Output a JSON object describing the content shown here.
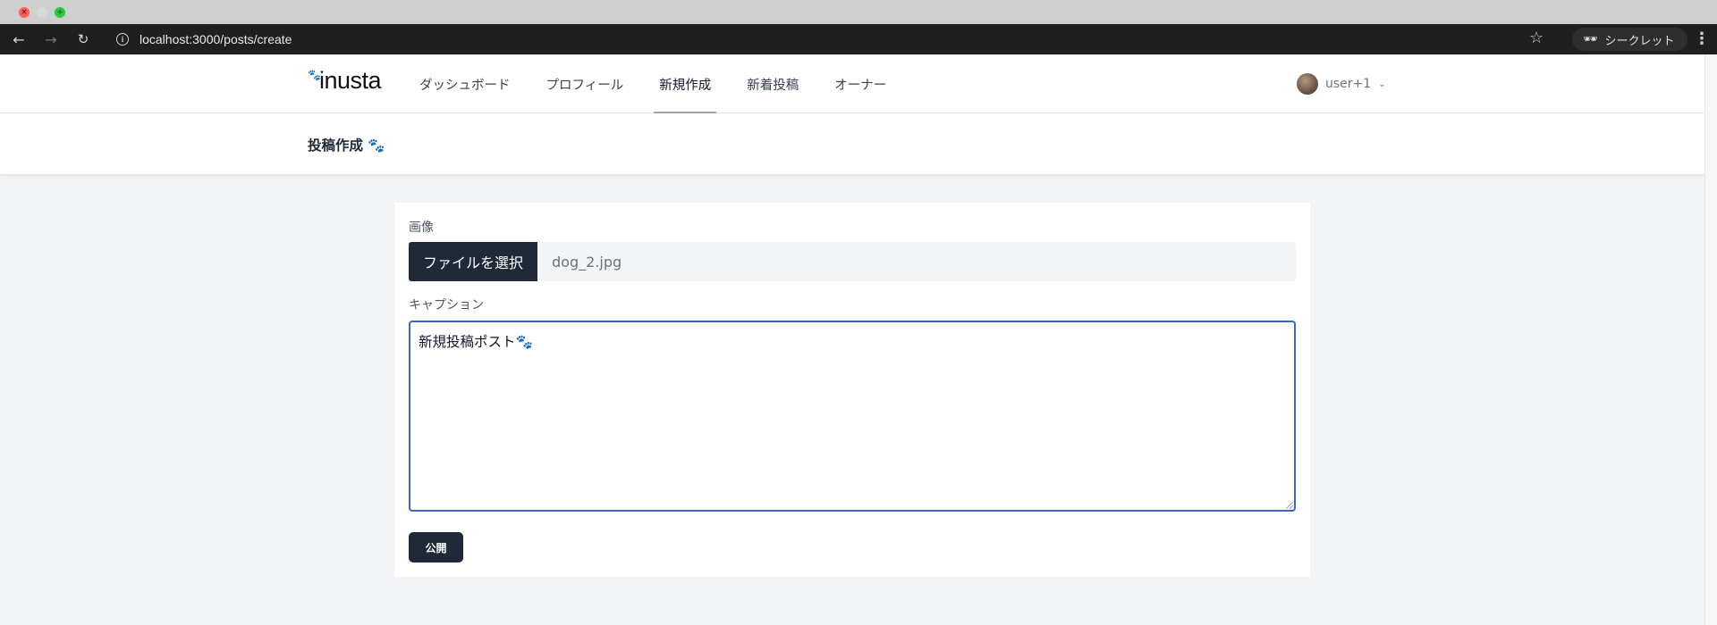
{
  "browser": {
    "url": "localhost:3000/posts/create",
    "incognito_label": "シークレット",
    "icons": {
      "close": "close-icon",
      "minimize": "minimize-icon",
      "maximize": "maximize-icon",
      "back": "back-arrow-icon",
      "forward": "forward-arrow-icon",
      "reload": "reload-icon",
      "info": "info-icon",
      "bookmark": "star-icon",
      "incognito": "incognito-icon",
      "menu": "more-vertical-icon"
    }
  },
  "header": {
    "logo_text": "inusta",
    "logo_icon": "paw-icon",
    "nav": [
      {
        "label": "ダッシュボード",
        "active": false
      },
      {
        "label": "プロフィール",
        "active": false
      },
      {
        "label": "新規作成",
        "active": true
      },
      {
        "label": "新着投稿",
        "active": false
      },
      {
        "label": "オーナー",
        "active": false
      }
    ],
    "user": {
      "name": "user+1",
      "avatar_icon": "avatar-icon",
      "dropdown_icon": "chevron-down-icon"
    }
  },
  "page": {
    "title": "投稿作成 🐾"
  },
  "form": {
    "image_label": "画像",
    "file_button": "ファイルを選択",
    "file_name": "dog_2.jpg",
    "caption_label": "キャプション",
    "caption_value": "新規投稿ポスト🐾",
    "submit_label": "公開"
  },
  "colors": {
    "page_bg": "#f3f4f6",
    "dark_button": "#1f2937",
    "focus_border": "#3b66c9",
    "browser_toolbar": "#1f1f1f"
  }
}
